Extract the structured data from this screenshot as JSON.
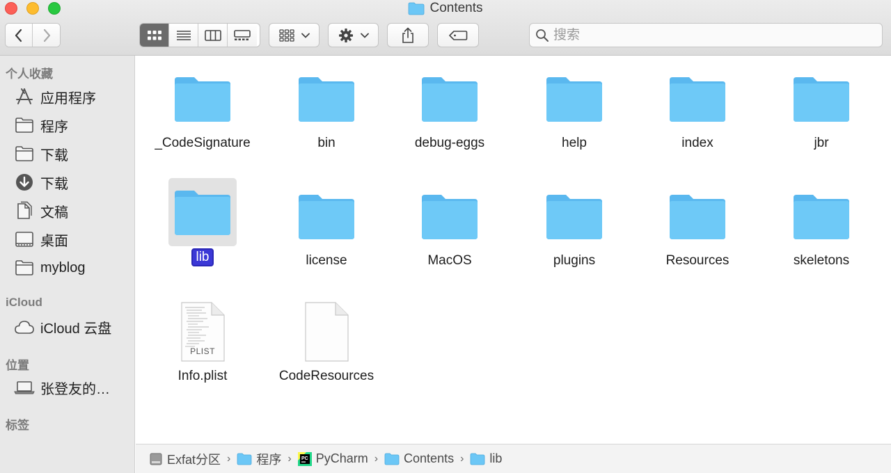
{
  "window": {
    "title": "Contents"
  },
  "toolbar": {
    "back_icon": "chevron-left-icon",
    "forward_icon": "chevron-right-icon",
    "view_modes": [
      "icon-view",
      "list-view",
      "column-view",
      "gallery-view"
    ],
    "active_view": "icon-view",
    "group_icon": "group-grid-icon",
    "action_icon": "gear-icon",
    "share_icon": "share-icon",
    "tag_icon": "tag-icon"
  },
  "search": {
    "placeholder": "搜索",
    "value": ""
  },
  "sidebar": {
    "favorites_header": "个人收藏",
    "favorites": [
      {
        "label": "应用程序",
        "icon": "applications-icon"
      },
      {
        "label": "程序",
        "icon": "folder-icon"
      },
      {
        "label": "下载",
        "icon": "folder-icon"
      },
      {
        "label": "下载",
        "icon": "downloads-icon"
      },
      {
        "label": "文稿",
        "icon": "documents-icon"
      },
      {
        "label": "桌面",
        "icon": "desktop-icon"
      },
      {
        "label": "myblog",
        "icon": "folder-icon"
      }
    ],
    "icloud_header": "iCloud",
    "icloud": [
      {
        "label": "iCloud 云盘",
        "icon": "cloud-icon"
      }
    ],
    "locations_header": "位置",
    "locations": [
      {
        "label": "张登友的…",
        "icon": "laptop-icon"
      }
    ],
    "tags_header": "标签"
  },
  "files": [
    {
      "name": "_CodeSignature",
      "kind": "folder"
    },
    {
      "name": "bin",
      "kind": "folder"
    },
    {
      "name": "debug-eggs",
      "kind": "folder"
    },
    {
      "name": "help",
      "kind": "folder"
    },
    {
      "name": "index",
      "kind": "folder"
    },
    {
      "name": "jbr",
      "kind": "folder"
    },
    {
      "name": "lib",
      "kind": "folder",
      "selected": true
    },
    {
      "name": "license",
      "kind": "folder"
    },
    {
      "name": "MacOS",
      "kind": "folder"
    },
    {
      "name": "plugins",
      "kind": "folder"
    },
    {
      "name": "Resources",
      "kind": "folder"
    },
    {
      "name": "skeletons",
      "kind": "folder"
    },
    {
      "name": "Info.plist",
      "kind": "plist",
      "badge": "PLIST"
    },
    {
      "name": "CodeResources",
      "kind": "document"
    }
  ],
  "pathbar": [
    {
      "label": "Exfat分区",
      "icon": "drive-icon"
    },
    {
      "label": "程序",
      "icon": "folder-icon"
    },
    {
      "label": "PyCharm",
      "icon": "pycharm-icon"
    },
    {
      "label": "Contents",
      "icon": "folder-icon"
    },
    {
      "label": "lib",
      "icon": "folder-icon"
    }
  ],
  "colors": {
    "folder_blue": "#6cc7f6",
    "selection_blue": "#3b38d6",
    "sidebar_bg": "#e8e8e8"
  }
}
